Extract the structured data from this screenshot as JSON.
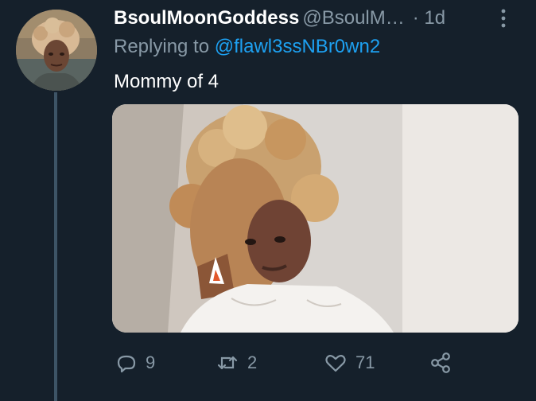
{
  "tweet": {
    "display_name": "BsoulMoonGoddess",
    "handle": "@BsoulM…",
    "separator": "·",
    "time": "1d",
    "reply_prefix": "Replying to",
    "reply_mention": "@flawl3ssNBr0wn2",
    "text": "Mommy of 4"
  },
  "actions": {
    "reply_count": "9",
    "retweet_count": "2",
    "like_count": "71"
  },
  "icons": {
    "more": "more-vertical-icon",
    "reply": "comment-icon",
    "retweet": "retweet-icon",
    "like": "heart-icon",
    "share": "share-icon"
  },
  "colors": {
    "background": "#15202b",
    "primary_text": "#ffffff",
    "secondary_text": "#8899a6",
    "link": "#1da1f2",
    "thread_line": "#3d5466"
  }
}
